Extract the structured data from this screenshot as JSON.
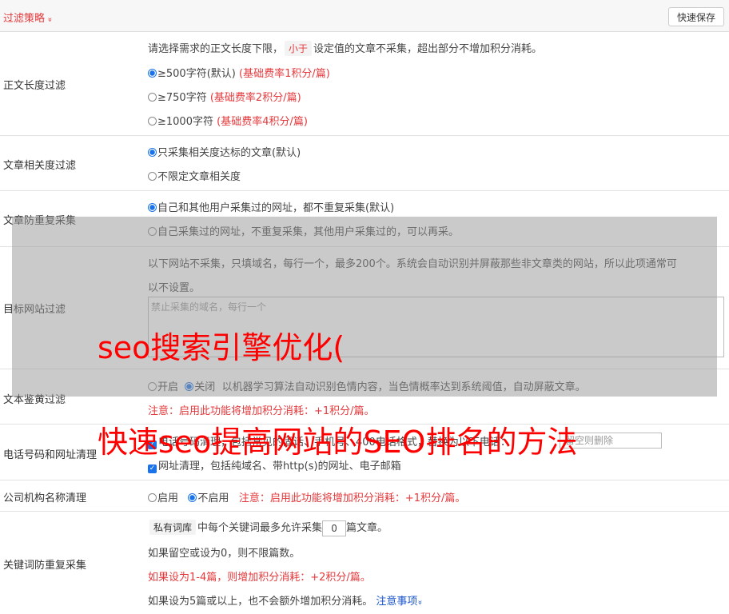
{
  "header": {
    "title": "过滤策略",
    "title_chevron": "»",
    "save_button": "快速保存"
  },
  "length_filter": {
    "label": "正文长度过滤",
    "desc_before": "请选择需求的正文长度下限，",
    "desc_tag": "小于",
    "desc_after": "设定值的文章不采集，超出部分不增加积分消耗。",
    "options": [
      {
        "text": "≥500字符(默认)",
        "note": "(基础费率1积分/篇)",
        "selected": true
      },
      {
        "text": "≥750字符",
        "note": "(基础费率2积分/篇)",
        "selected": false
      },
      {
        "text": "≥1000字符",
        "note": "(基础费率4积分/篇)",
        "selected": false
      }
    ]
  },
  "relevance_filter": {
    "label": "文章相关度过滤",
    "options": [
      {
        "text": "只采集相关度达标的文章(默认)",
        "selected": true
      },
      {
        "text": "不限定文章相关度",
        "selected": false
      }
    ]
  },
  "duplicate_filter": {
    "label": "文章防重复采集",
    "options": [
      {
        "text": "自己和其他用户采集过的网址，都不重复采集(默认)",
        "selected": true
      },
      {
        "text": "自己采集过的网址，不重复采集，其他用户采集过的，可以再采。",
        "selected": false
      }
    ]
  },
  "site_filter": {
    "label": "目标网站过滤",
    "desc_line1": "以下网站不采集，只填域名，每行一个，最多200个。系统会自动识别并屏蔽那些非文章类的网站，所以此项通常可",
    "desc_line2": "以不设置。",
    "textarea_placeholder": "禁止采集的域名，每行一个"
  },
  "porn_filter": {
    "label": "文本鉴黄过滤",
    "on_label": "开启",
    "off_label": "关闭",
    "selected": "off",
    "desc": "以机器学习算法自动识别色情内容，当色情概率达到系统阈值，自动屏蔽文章。",
    "notice": "注意：启用此功能将增加积分消耗：+1积分/篇。"
  },
  "phone_filter": {
    "label": "电话号码和网址清理",
    "phone_text": "电话号码清理，包括常见的固话、手机号、400电话格式，替换为以下电话：",
    "phone_placeholder": "留空则删除",
    "url_text": "网址清理，包括纯域名、带http(s)的网址、电子邮箱",
    "phone_checked": true,
    "url_checked": true
  },
  "org_filter": {
    "label": "公司机构名称清理",
    "on_label": "启用",
    "off_label": "不启用",
    "selected": "off",
    "notice": "注意：启用此功能将增加积分消耗：+1积分/篇。"
  },
  "keyword_filter": {
    "label": "关键词防重复采集",
    "tag": "私有词库",
    "line1_mid": "中每个关键词最多允许采集",
    "count": "0",
    "line1_end": "篇文章。",
    "line2": "如果留空或设为0，则不限篇数。",
    "line3": "如果设为1-4篇，则增加积分消耗：+2积分/篇。",
    "line4": "如果设为5篇或以上，也不会额外增加积分消耗。",
    "notes_link": "注意事项",
    "notes_chevron": "»"
  },
  "watermark": {
    "line1": "seo搜索引擎优化(",
    "line2": "快速seo提高网站的SEO排名的方法"
  }
}
